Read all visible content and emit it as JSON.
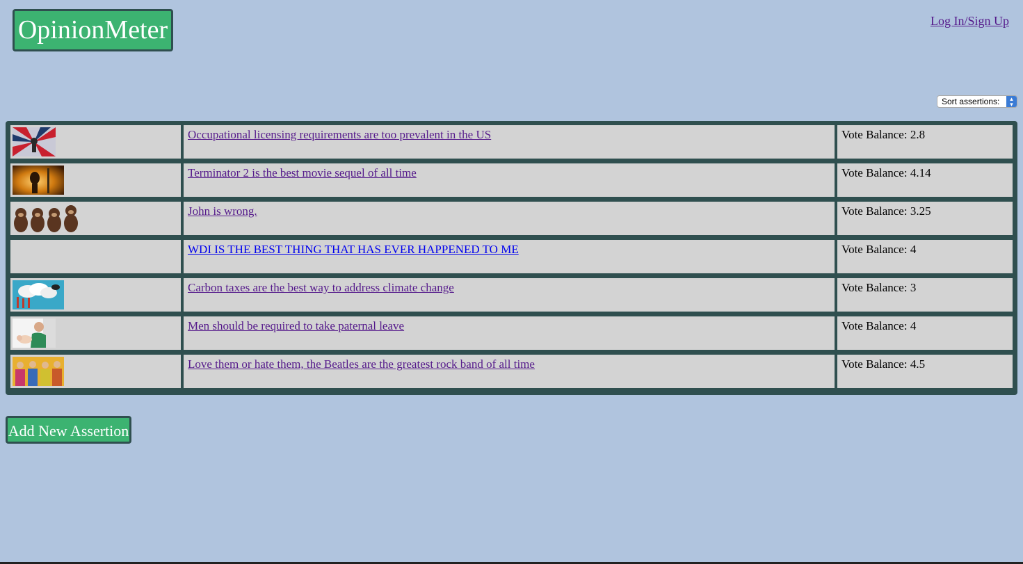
{
  "header": {
    "logo_text": "OpinionMeter",
    "login_link": "Log In/Sign Up"
  },
  "sort": {
    "label": "Sort assertions:"
  },
  "assertions": [
    {
      "title": "Occupational licensing requirements are too prevalent in the US",
      "vote": "Vote Balance: 2.8",
      "has_image": true,
      "image": "occupational-licensing-thumbnail"
    },
    {
      "title": "Terminator 2 is the best movie sequel of all time",
      "vote": "Vote Balance: 4.14",
      "has_image": true,
      "image": "terminator-thumbnail"
    },
    {
      "title": "John is wrong.",
      "vote": "Vote Balance: 3.25",
      "has_image": true,
      "image": "monkeys-thumbnail"
    },
    {
      "title": "WDI IS THE BEST THING THAT HAS EVER HAPPENED TO ME",
      "vote": "Vote Balance: 4",
      "has_image": false
    },
    {
      "title": "Carbon taxes are the best way to address climate change",
      "vote": "Vote Balance: 3",
      "has_image": true,
      "image": "carbon-cloud-thumbnail"
    },
    {
      "title": "Men should be required to take paternal leave",
      "vote": "Vote Balance: 4",
      "has_image": true,
      "image": "father-baby-thumbnail"
    },
    {
      "title": "Love them or hate them, the Beatles are the greatest rock band of all time",
      "vote": "Vote Balance: 4.5",
      "has_image": true,
      "image": "beatles-thumbnail"
    }
  ],
  "add_button": "Add New Assertion",
  "colors": {
    "background": "#b0c4de",
    "accent": "#3cb371",
    "border": "#2f4f4f",
    "cell": "#d3d3d3"
  }
}
